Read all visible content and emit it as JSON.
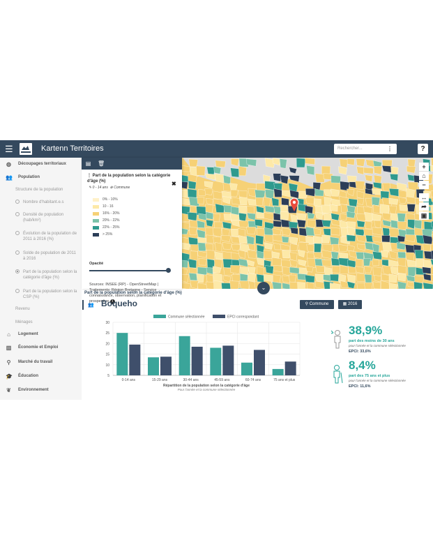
{
  "header": {
    "title": "Kartenn Territoires",
    "search_placeholder": "Rechercher...",
    "search_dots": "⋮",
    "help": "?"
  },
  "sidebar": {
    "items": [
      {
        "type": "main",
        "icon": "globe-icon",
        "label": "Découpages territoriaux"
      },
      {
        "type": "main",
        "icon": "users-icon",
        "label": "Population"
      },
      {
        "type": "sub",
        "label": "Structure de la population"
      },
      {
        "type": "ind",
        "label": "Nombre d'habitant.e.s"
      },
      {
        "type": "ind",
        "label": "Densité de population (hab/km²)"
      },
      {
        "type": "ind",
        "label": "Évolution de la population de 2011 à 2016 (%)"
      },
      {
        "type": "ind",
        "label": "Solde de population de 2011 à 2016"
      },
      {
        "type": "ind",
        "label": "Part de la population selon la catégorie d'âge (%)",
        "active": true
      },
      {
        "type": "ind",
        "label": "Part de la population selon la CSP (%)"
      },
      {
        "type": "sub",
        "label": "Revenu"
      },
      {
        "type": "sub",
        "label": "Ménages"
      },
      {
        "type": "main",
        "icon": "home-icon",
        "label": "Logement"
      },
      {
        "type": "main",
        "icon": "factory-icon",
        "label": "Économie et Emploi"
      },
      {
        "type": "main",
        "icon": "search-icon",
        "label": "Marché du travail"
      },
      {
        "type": "main",
        "icon": "graduation-cap-icon",
        "label": "Éducation"
      },
      {
        "type": "main",
        "icon": "leaf-icon",
        "label": "Environnement"
      }
    ]
  },
  "panel": {
    "title": "Part de la population selon la catégorie d'âge (%)",
    "tag_age": "0 - 14 ans",
    "tag_scale": "Commune",
    "legend": [
      {
        "label": "0% - 10%",
        "color": "#fff1c8"
      },
      {
        "label": "10 - 16",
        "color": "#fde9a8"
      },
      {
        "label": "16% - 20%",
        "color": "#f6d176"
      },
      {
        "label": "20% - 22%",
        "color": "#7cc3aa"
      },
      {
        "label": "22% - 25%",
        "color": "#2f9a8e"
      },
      {
        "label": "> 25%",
        "color": "#2c3e58"
      }
    ],
    "opacity_label": "Opacité",
    "opacity_value": 1,
    "sources": "Sources: INSEE (RP) - OpenStreetMap | Traitements: Région Bretagne - Service connaissance, observation, planification et prospective"
  },
  "map_controls": {
    "zoom_in": "+",
    "home": "⌂",
    "zoom_out": "−",
    "measure": "↔",
    "share": "➦",
    "image": "▣"
  },
  "content": {
    "chart_heading": "Part de la population selon la catégorie d'âge (%)",
    "commune": "Boqueho",
    "btn_commune": "Commune",
    "btn_year": "2016"
  },
  "chart_data": {
    "type": "bar",
    "categories": [
      "0-14 ans",
      "15-29 ans",
      "30-44 ans",
      "45-59 ans",
      "60-74 ans",
      "75 ans et plus"
    ],
    "series": [
      {
        "name": "Commune sélectionnée",
        "color": "#3aa59a",
        "values": [
          25,
          13.5,
          23.5,
          18,
          11,
          8
        ]
      },
      {
        "name": "EPCI correspondant",
        "color": "#3f4f6b",
        "values": [
          19.5,
          13.8,
          18.5,
          19,
          17,
          11.5
        ]
      }
    ],
    "ylim": [
      5,
      30
    ],
    "yticks": [
      5,
      10,
      15,
      20,
      25,
      30
    ],
    "xlabel": "Répartition de la population selon la catégorie d'âge",
    "subtitle": "Pour l'année et la commune sélectionnée",
    "grid": true,
    "legend": "top"
  },
  "stats": [
    {
      "value": "38,9%",
      "label": "part des moins de 30 ans",
      "sub": "pour l'année et la commune sélectionnée",
      "epci": "EPCI: 33,6%",
      "icon": "young-person-icon"
    },
    {
      "value": "8,4%",
      "label": "part des 75 ans et plus",
      "sub": "pour l'année et la commune sélectionnée",
      "epci": "EPCI: 11,6%",
      "icon": "elderly-person-icon"
    }
  ]
}
